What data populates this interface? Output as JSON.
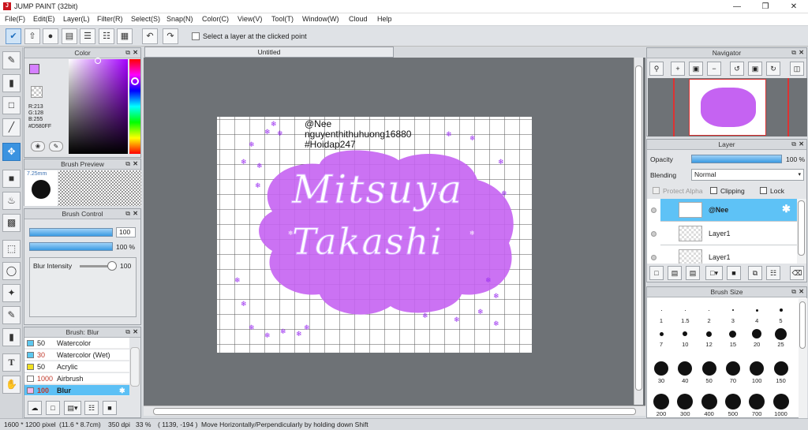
{
  "window": {
    "title": "JUMP PAINT (32bit)",
    "icon": "app-icon"
  },
  "menu": [
    "File(F)",
    "Edit(E)",
    "Layer(L)",
    "Filter(R)",
    "Select(S)",
    "Snap(N)",
    "Color(C)",
    "View(V)",
    "Tool(T)",
    "Window(W)",
    "Cloud",
    "Help"
  ],
  "toolbar": {
    "select_layer_label": "Select a layer at the clicked point"
  },
  "color_panel": {
    "title": "Color",
    "r": "R:213",
    "g": "G:128",
    "b": "B:255",
    "hex": "#D580FF",
    "accent": "#D580FF"
  },
  "brush_preview": {
    "title": "Brush Preview",
    "size": "7.25mm"
  },
  "brush_control": {
    "title": "Brush Control",
    "size_value": "100",
    "opacity_value": "100 %",
    "blur_label": "Blur Intensity",
    "blur_value": "100"
  },
  "brush_list": {
    "title": "Brush: Blur",
    "items": [
      {
        "size": "50",
        "name": "Watercolor",
        "color": "#5cc8f0"
      },
      {
        "size": "30",
        "name": "Watercolor (Wet)",
        "color": "#5cc8f0"
      },
      {
        "size": "50",
        "name": "Acrylic",
        "color": "#f0e020"
      },
      {
        "size": "1000",
        "name": "Airbrush",
        "color": "#ffffff"
      },
      {
        "size": "100",
        "name": "Blur",
        "color": "#f5b8e8"
      }
    ]
  },
  "canvas": {
    "tab": "Untitled",
    "watermark_lines": [
      "@Nee",
      "nguyenthithuhuong16880",
      "#Hoidap247"
    ],
    "title_line1": "Mitsuya",
    "title_line2": "Takashi"
  },
  "navigator": {
    "title": "Navigator"
  },
  "layer_panel": {
    "title": "Layer",
    "opacity_label": "Opacity",
    "opacity_value": "100 %",
    "blending_label": "Blending",
    "blending_value": "Normal",
    "protect_alpha": "Protect Alpha",
    "clipping": "Clipping",
    "lock": "Lock",
    "layers": [
      "@Nee",
      "Layer1",
      "Layer1"
    ]
  },
  "brush_size": {
    "title": "Brush Size",
    "row1": [
      "1",
      "1.5",
      "2",
      "3",
      "4",
      "5"
    ],
    "row2": [
      "7",
      "10",
      "12",
      "15",
      "20",
      "25"
    ],
    "row3": [
      "30",
      "40",
      "50",
      "70",
      "100",
      "150"
    ],
    "row4": [
      "200",
      "300",
      "400",
      "500",
      "700",
      "1000"
    ]
  },
  "status": {
    "pixels": "1600 * 1200 pixel",
    "cm": "(11.6 * 8.7cm)",
    "dpi": "350 dpi",
    "zoom": "33 %",
    "coords": "( 1139, -194 )",
    "hint": "Move Horizontally/Perpendicularly by holding down Shift"
  }
}
